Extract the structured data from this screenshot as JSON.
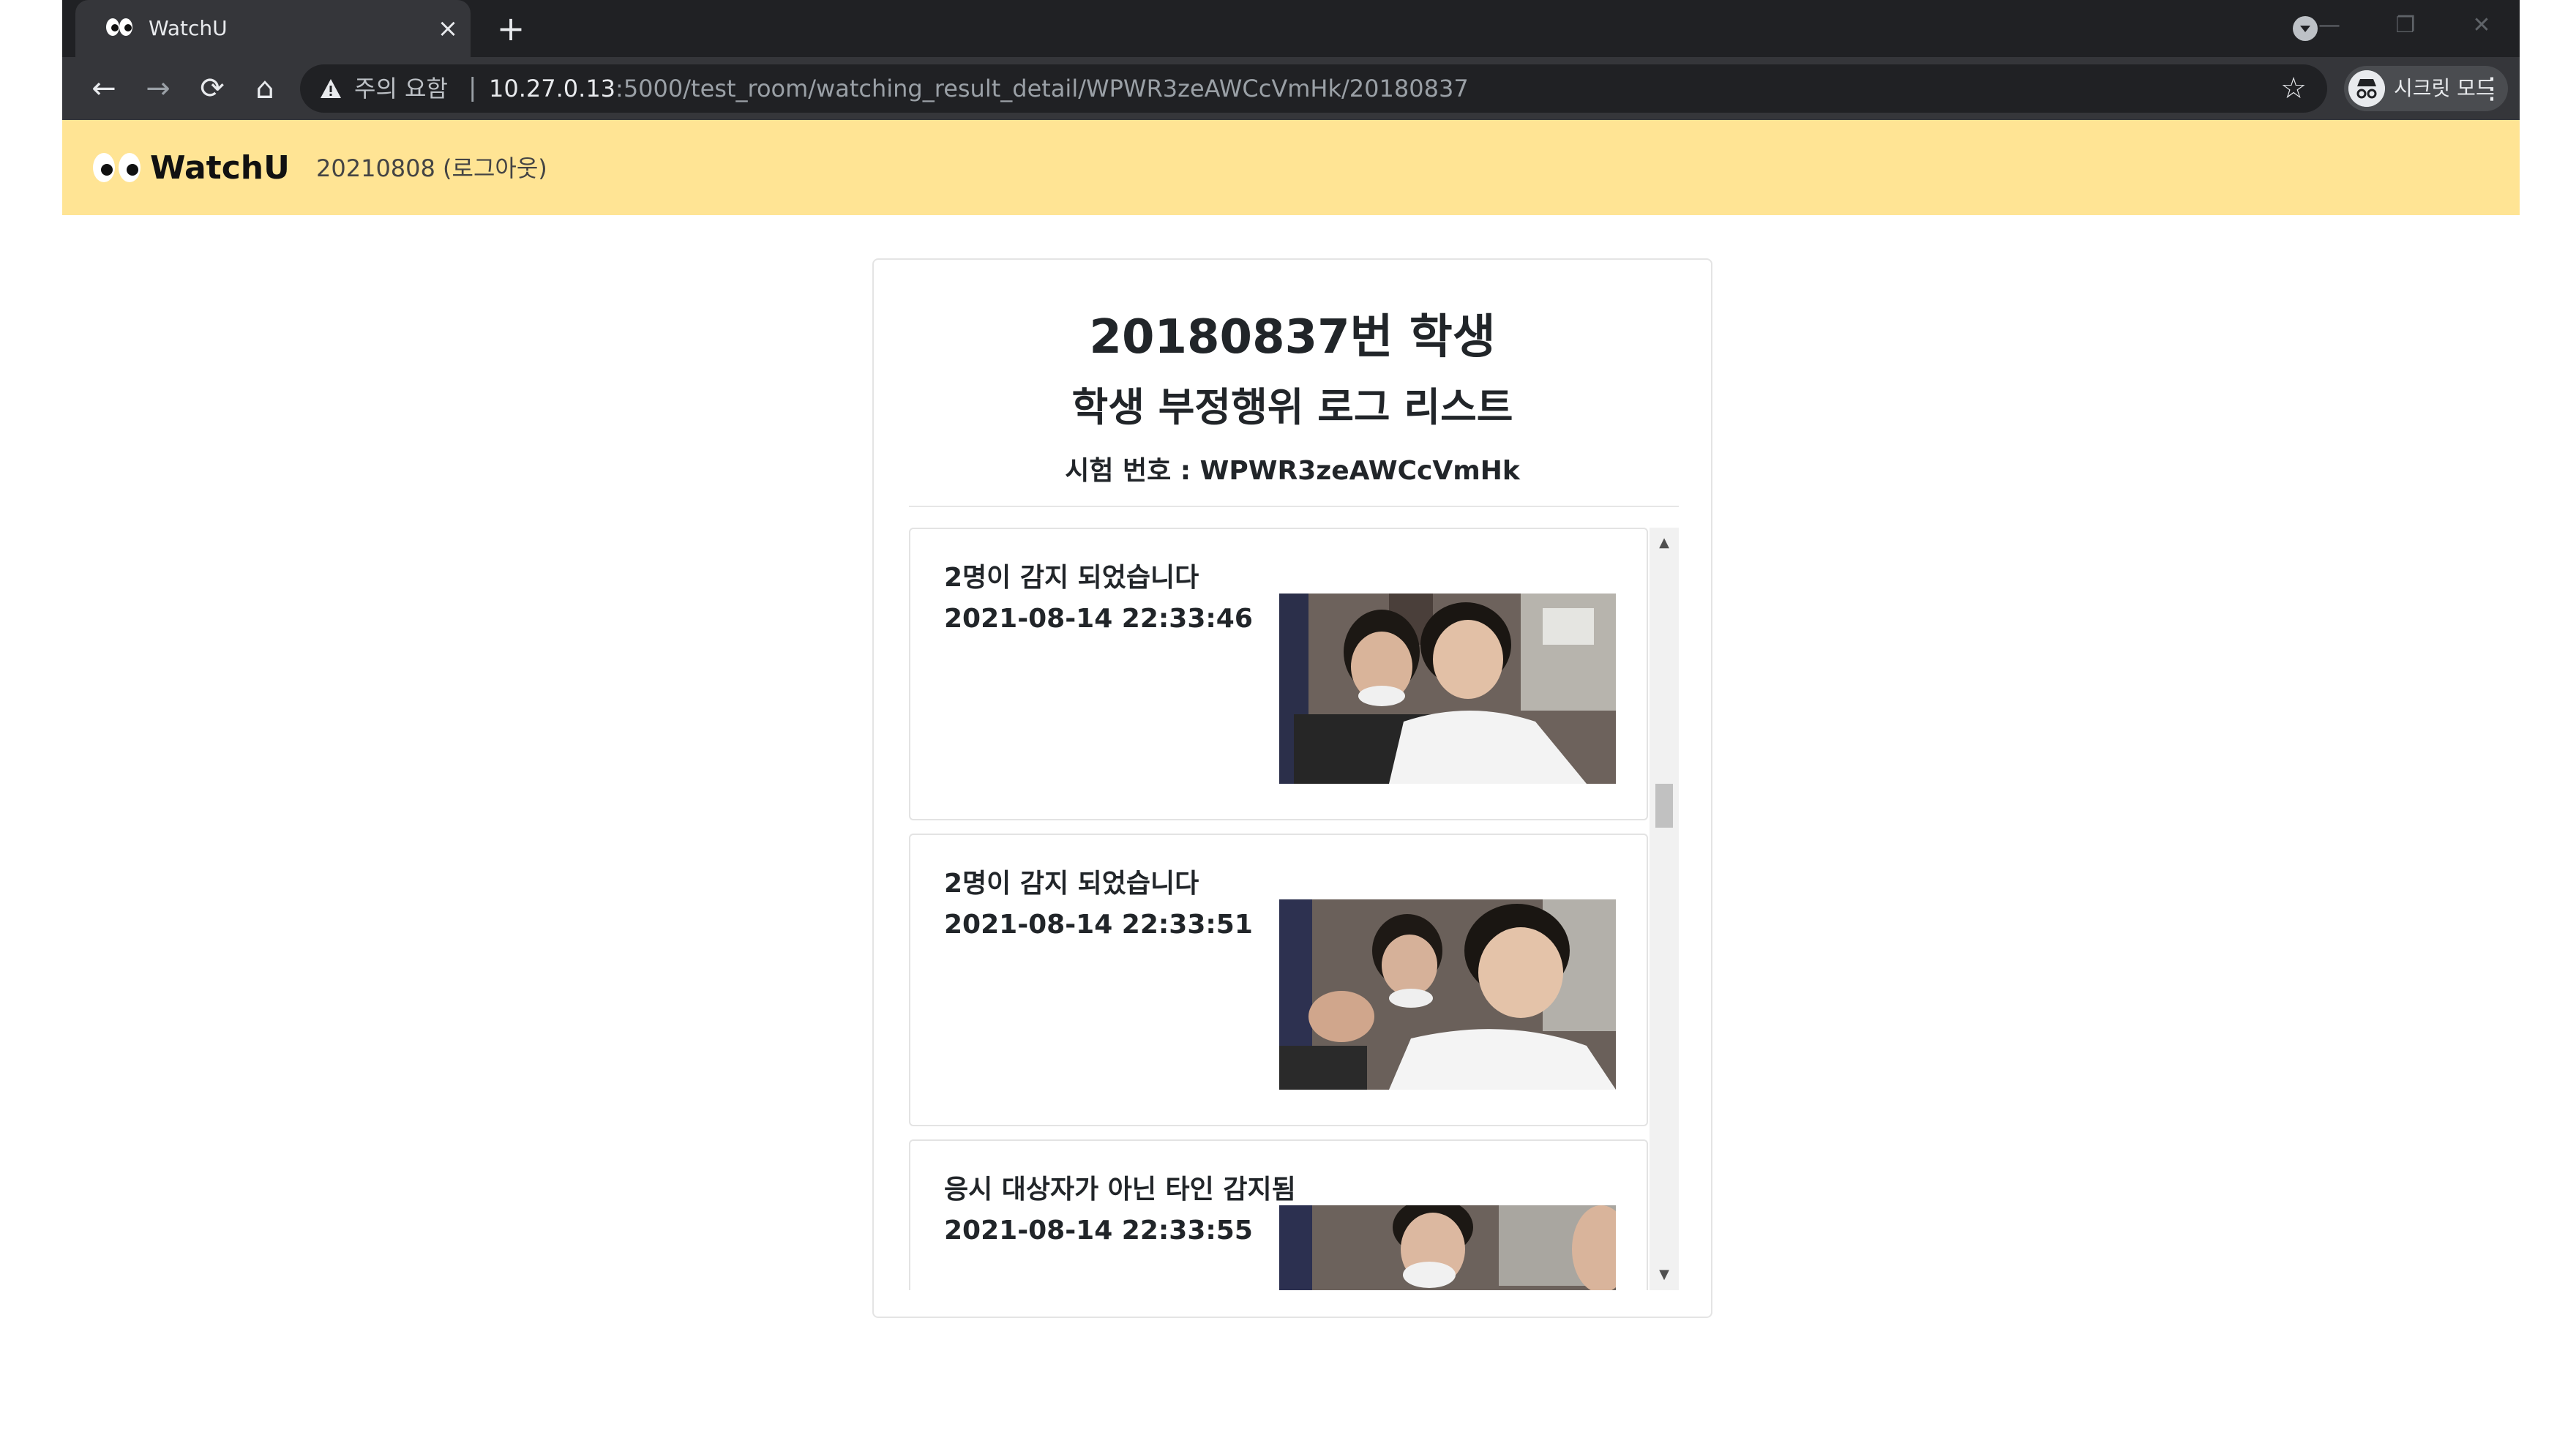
{
  "browser": {
    "tab_title": "WatchU",
    "tab_close": "×",
    "new_tab": "+",
    "security_warning": "주의 요함",
    "url_host": "10.27.0.13",
    "url_path": ":5000/test_room/watching_result_detail/WPWR3zeAWCcVmHk/20180837",
    "profile_label": "시크릿 모드",
    "icons": [
      "back-arrow-icon",
      "forward-arrow-icon",
      "reload-icon",
      "home-icon",
      "warning-icon",
      "star-icon",
      "incognito-icon",
      "menu-icon"
    ]
  },
  "navbar": {
    "brand": "WatchU",
    "user": "20210808 (로그아웃)",
    "background": "#ffe494"
  },
  "card": {
    "title": "20180837번 학생",
    "subtitle": "학생 부정행위 로그 리스트",
    "exam_number": "시험 번호 : WPWR3zeAWCcVmHk"
  },
  "logs": [
    {
      "message": "2명이 감지 되었습니다",
      "time": "2021-08-14 22:33:46"
    },
    {
      "message": "2명이 감지 되었습니다",
      "time": "2021-08-14 22:33:51"
    },
    {
      "message": "응시 대상자가 아닌 타인 감지됨",
      "time": "2021-08-14 22:33:55"
    }
  ]
}
